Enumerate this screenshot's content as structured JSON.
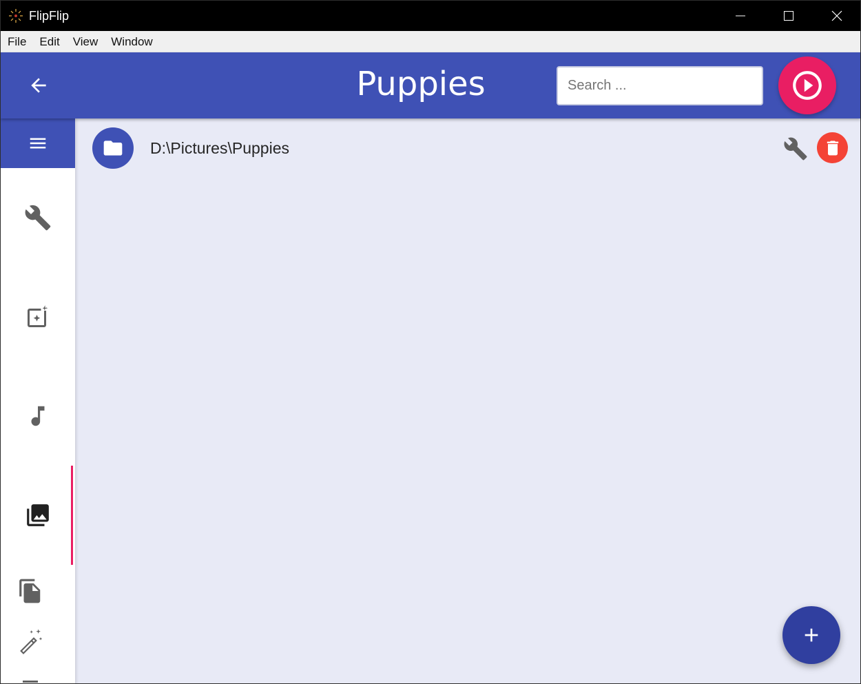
{
  "window": {
    "title": "FlipFlip",
    "controls": {
      "minimize_icon": "minimize-icon",
      "maximize_icon": "maximize-icon",
      "close_icon": "close-icon"
    }
  },
  "menubar": {
    "items": [
      {
        "label": "File"
      },
      {
        "label": "Edit"
      },
      {
        "label": "View"
      },
      {
        "label": "Window"
      }
    ]
  },
  "header": {
    "back_icon": "arrow-back-icon",
    "title": "Puppies",
    "search": {
      "placeholder": "Search ...",
      "value": ""
    },
    "play_icon": "play-circle-icon"
  },
  "sidebar": {
    "menu_icon": "hamburger-menu-icon",
    "items": [
      {
        "icon": "wrench-icon",
        "name": "options",
        "active": false
      },
      {
        "icon": "image-effects-icon",
        "name": "effects",
        "active": false
      },
      {
        "icon": "music-note-icon",
        "name": "audio",
        "active": false
      },
      {
        "icon": "photo-library-icon",
        "name": "sources",
        "active": true
      },
      {
        "icon": "file-copy-icon",
        "name": "copy",
        "active": false
      },
      {
        "icon": "magic-wand-icon",
        "name": "generate",
        "active": false
      }
    ]
  },
  "sources": [
    {
      "path": "D:\\Pictures\\Puppies",
      "icon": "folder-icon"
    }
  ],
  "fab": {
    "icon": "plus-icon"
  },
  "colors": {
    "primary": "#3f51b5",
    "primary_dark": "#303f9f",
    "accent": "#e91e63",
    "danger": "#f44336",
    "content_bg": "#e8eaf6"
  }
}
